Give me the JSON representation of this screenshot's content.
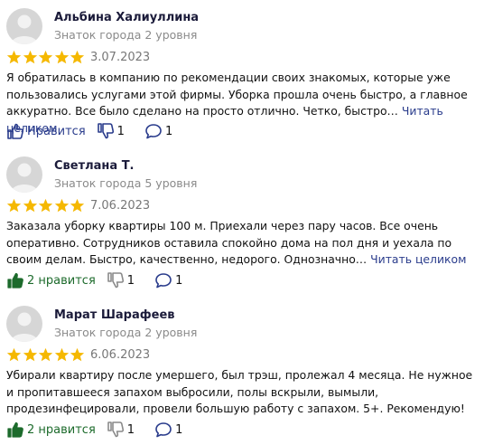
{
  "reviews": [
    {
      "author": "Альбина Халиуллина",
      "level": "Знаток города 2 уровня",
      "rating": 5,
      "date": "3.07.2023",
      "text": "Я обратилась в компанию по рекомендации своих знакомых, которые уже пользовались услугами этой фирмы. Уборка прошла очень быстро, а главное аккуратно. Все было сделано на просто отлично. Четко, быстро…",
      "read_more": "Читать целиком",
      "like_label": "Нравится",
      "dislike_count": "1",
      "comment_count": "1"
    },
    {
      "author": "Светлана Т.",
      "level": "Знаток города 5 уровня",
      "rating": 5,
      "date": "7.06.2023",
      "text": "Заказала уборку квартиры 100 м. Приехали через пару часов. Все очень оперативно. Сотрудников оставила спокойно дома на пол дня и уехала по своим делам. Быстро, качественно, недорого. Однозначно…",
      "read_more": "Читать целиком",
      "like_label": "2 нравится",
      "dislike_count": "1",
      "comment_count": "1"
    },
    {
      "author": "Марат Шарафеев",
      "level": "Знаток города 2 уровня",
      "rating": 5,
      "date": "6.06.2023",
      "text": "Убирали квартиру после умершего, был трэш, пролежал 4 месяца. Не нужное и пропитавшееся запахом выбросили, полы вскрыли, вымыли, продезинфецировали, провели большую работу с запахом. 5+. Рекомендую!",
      "like_label": "2 нравится",
      "dislike_count": "1",
      "comment_count": "1"
    }
  ],
  "colors": {
    "star": "#f5b800",
    "link": "#2a3c8c",
    "liked": "#1d6b2c"
  }
}
